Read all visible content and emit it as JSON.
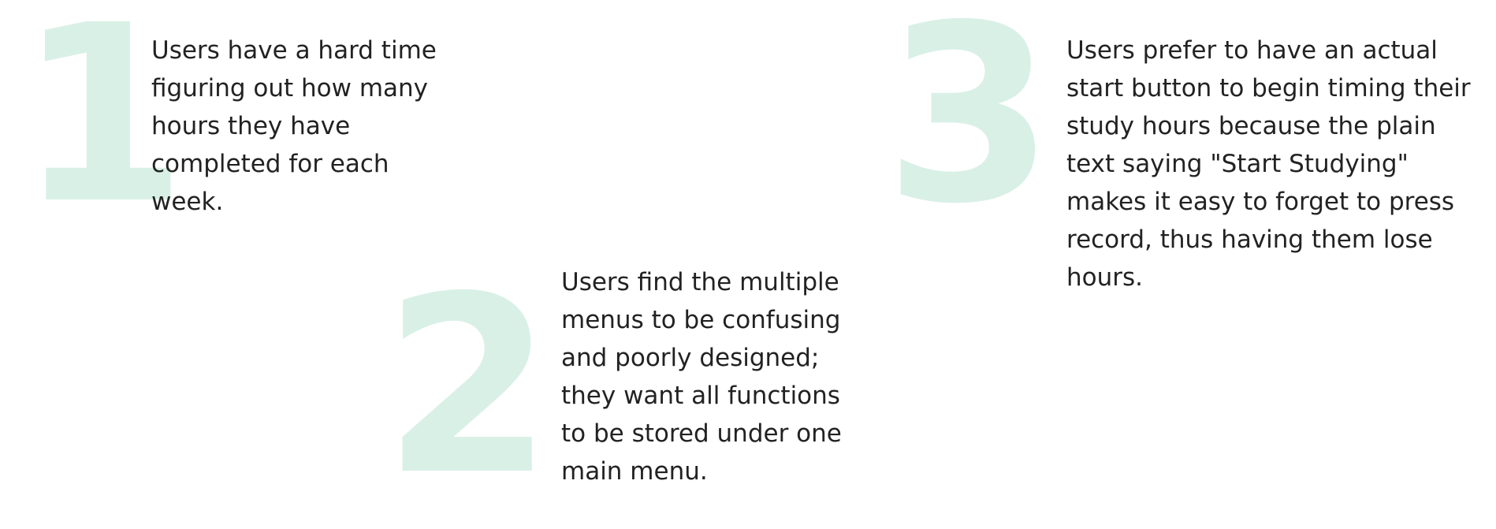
{
  "findings": [
    {
      "number": "1",
      "text": "Users have a hard time figuring out how many hours they have completed for each week."
    },
    {
      "number": "2",
      "text": "Users find the multiple menus to be confusing and poorly designed; they want all functions to be stored under one main menu."
    },
    {
      "number": "3",
      "text": "Users prefer to have an actual start button to begin timing their study hours because the plain text saying \"Start Studying\" makes it easy to forget to press record, thus having them lose hours."
    }
  ],
  "colors": {
    "numeral": "#d9f0e7",
    "text": "#222222",
    "background": "#ffffff"
  }
}
